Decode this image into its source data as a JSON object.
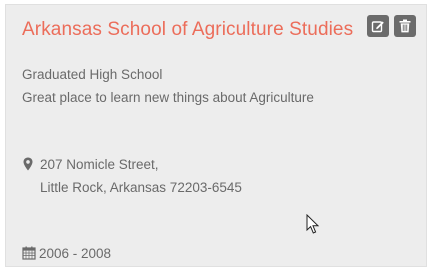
{
  "card": {
    "title": "Arkansas School of Agriculture Studies",
    "degree": "Graduated High School",
    "description": "Great place to learn new things about Agriculture",
    "address_line1": "207 Nomicle Street,",
    "address_line2": "Little Rock, Arkansas 72203-6545",
    "dates": "2006 - 2008",
    "title_color": "#ec6d5a"
  },
  "icons": {
    "edit": "edit-icon",
    "delete": "trash-icon",
    "location": "map-marker-icon",
    "calendar": "calendar-icon",
    "cursor": "mouse-pointer-icon"
  }
}
